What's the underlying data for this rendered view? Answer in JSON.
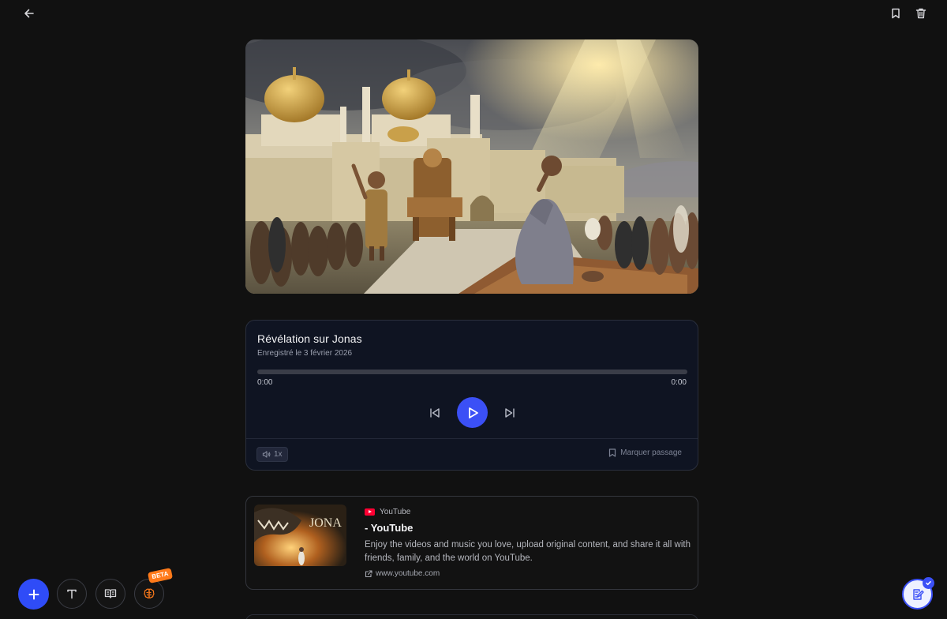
{
  "header": {
    "back_icon": "arrow-left-icon",
    "bookmark_icon": "bookmark-icon",
    "delete_icon": "trash-icon"
  },
  "hero": {
    "alt": "Painting of a man kneeling in prayer before a throne outside a domed city, crowds kneeling on both sides"
  },
  "audio": {
    "title": "Révélation sur Jonas",
    "subtitle": "Enregistré le 3 février 2026",
    "progress": 0,
    "current_time": "0:00",
    "duration": "0:00",
    "speed": "1x",
    "mark_label": "Marquer passage",
    "accent": "#3b50f6"
  },
  "link_preview": {
    "source": "YouTube",
    "title": "- YouTube",
    "description": "Enjoy the videos and music you love, upload original content, and share it all with friends, family, and the world on YouTube.",
    "url": "www.youtube.com",
    "thumb_text": "JONA"
  },
  "toolbar": {
    "add_icon": "plus-icon",
    "text_icon": "text-icon",
    "bible_icon": "open-book-icon",
    "brain_icon": "brain-icon",
    "beta_label": "BETA",
    "beta_color": "#ff7a1a"
  },
  "notes": {
    "icon": "notes-edit-icon"
  }
}
